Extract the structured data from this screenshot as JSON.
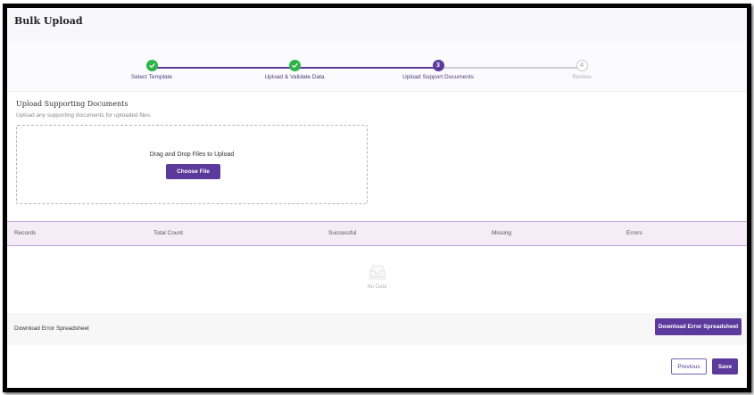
{
  "header": {
    "title": "Bulk Upload"
  },
  "stepper": {
    "steps": [
      {
        "number": "1",
        "label": "Select Template",
        "status": "completed"
      },
      {
        "number": "2",
        "label": "Upload & Validate Data",
        "status": "completed"
      },
      {
        "number": "3",
        "label": "Upload Support Documents",
        "status": "active"
      },
      {
        "number": "4",
        "label": "Review",
        "status": "pending"
      }
    ]
  },
  "upload": {
    "title": "Upload Supporting Documents",
    "subtitle": "Upload any supporting documents for uploaded files.",
    "dropzone_text": "Drag and Drop Files to Upload",
    "choose_label": "Choose File"
  },
  "table": {
    "columns": [
      "Records",
      "Total Count",
      "Successful",
      "Missing",
      "Errors"
    ],
    "empty_text": "No Data"
  },
  "download": {
    "label": "Download Error Spreadsheet",
    "button_label": "Download Error Spreadsheet"
  },
  "footer": {
    "previous_label": "Previous",
    "save_label": "Save"
  },
  "colors": {
    "accent": "#5b3a9b",
    "success": "#2fb34a",
    "table_header_bg": "#f6ecf8"
  }
}
